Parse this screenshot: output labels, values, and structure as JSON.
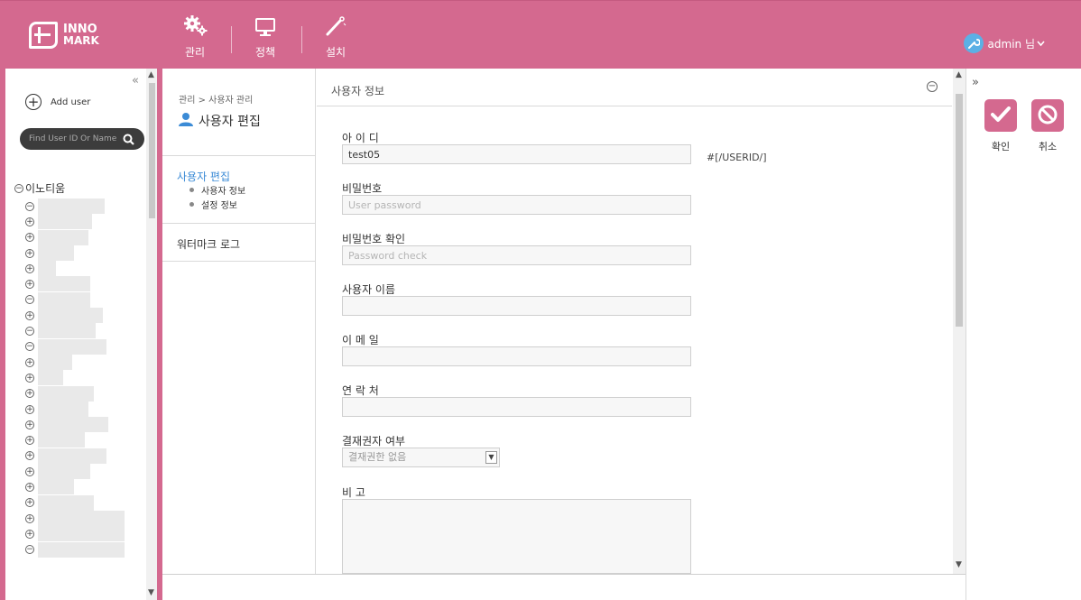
{
  "header": {
    "logo": {
      "line1": "INNO",
      "line2": "MARK"
    },
    "nav": [
      {
        "label": "관리",
        "icon": "gears-icon"
      },
      {
        "label": "정책",
        "icon": "monitor-icon"
      },
      {
        "label": "설치",
        "icon": "install-icon"
      }
    ],
    "user": {
      "label": "admin 님",
      "icon": "wrench-avatar-icon"
    }
  },
  "left_panel": {
    "collapse_glyph": "«",
    "add_user_label": "Add user",
    "search_placeholder": "Find User ID Or Name",
    "tree_root_label": "이노티움",
    "tree_toggles": [
      "⊖",
      "⊕",
      "⊕",
      "⊕",
      "⊕",
      "⊕",
      "⊖",
      "⊕",
      "⊖",
      "⊖",
      "⊕",
      "⊕",
      "⊕",
      "⊕",
      "⊕",
      "⊕",
      "⊕",
      "⊕",
      "⊕",
      "⊕",
      "⊕",
      "⊕",
      "⊕",
      "⊖"
    ]
  },
  "subnav": {
    "breadcrumb": "관리 > 사용자 관리",
    "title": "사용자 편집",
    "section_head": "사용자 편집",
    "section_items": [
      "사용자 정보",
      "설정 정보"
    ],
    "item2": "워터마크 로그"
  },
  "main": {
    "section_title": "사용자 정보",
    "collapse_glyph": "−",
    "fields": {
      "id": {
        "label": "아 이 디",
        "value": "test05",
        "hint": "#[/USERID/]"
      },
      "password": {
        "label": "비밀번호",
        "placeholder": "User password"
      },
      "password_confirm": {
        "label": "비밀번호 확인",
        "placeholder": "Password check"
      },
      "name": {
        "label": "사용자 이름",
        "value": ""
      },
      "email": {
        "label": "이 메 일",
        "value": ""
      },
      "phone": {
        "label": "연 락 처",
        "value": ""
      },
      "approver": {
        "label": "결재권자 여부",
        "selected": "결재권한 없음"
      },
      "memo": {
        "label": "비 고"
      }
    }
  },
  "right_panel": {
    "expand_glyph": "»",
    "confirm_label": "확인",
    "cancel_label": "취소"
  },
  "colors": {
    "brand": "#d4698f",
    "link": "#3b8bd6"
  }
}
